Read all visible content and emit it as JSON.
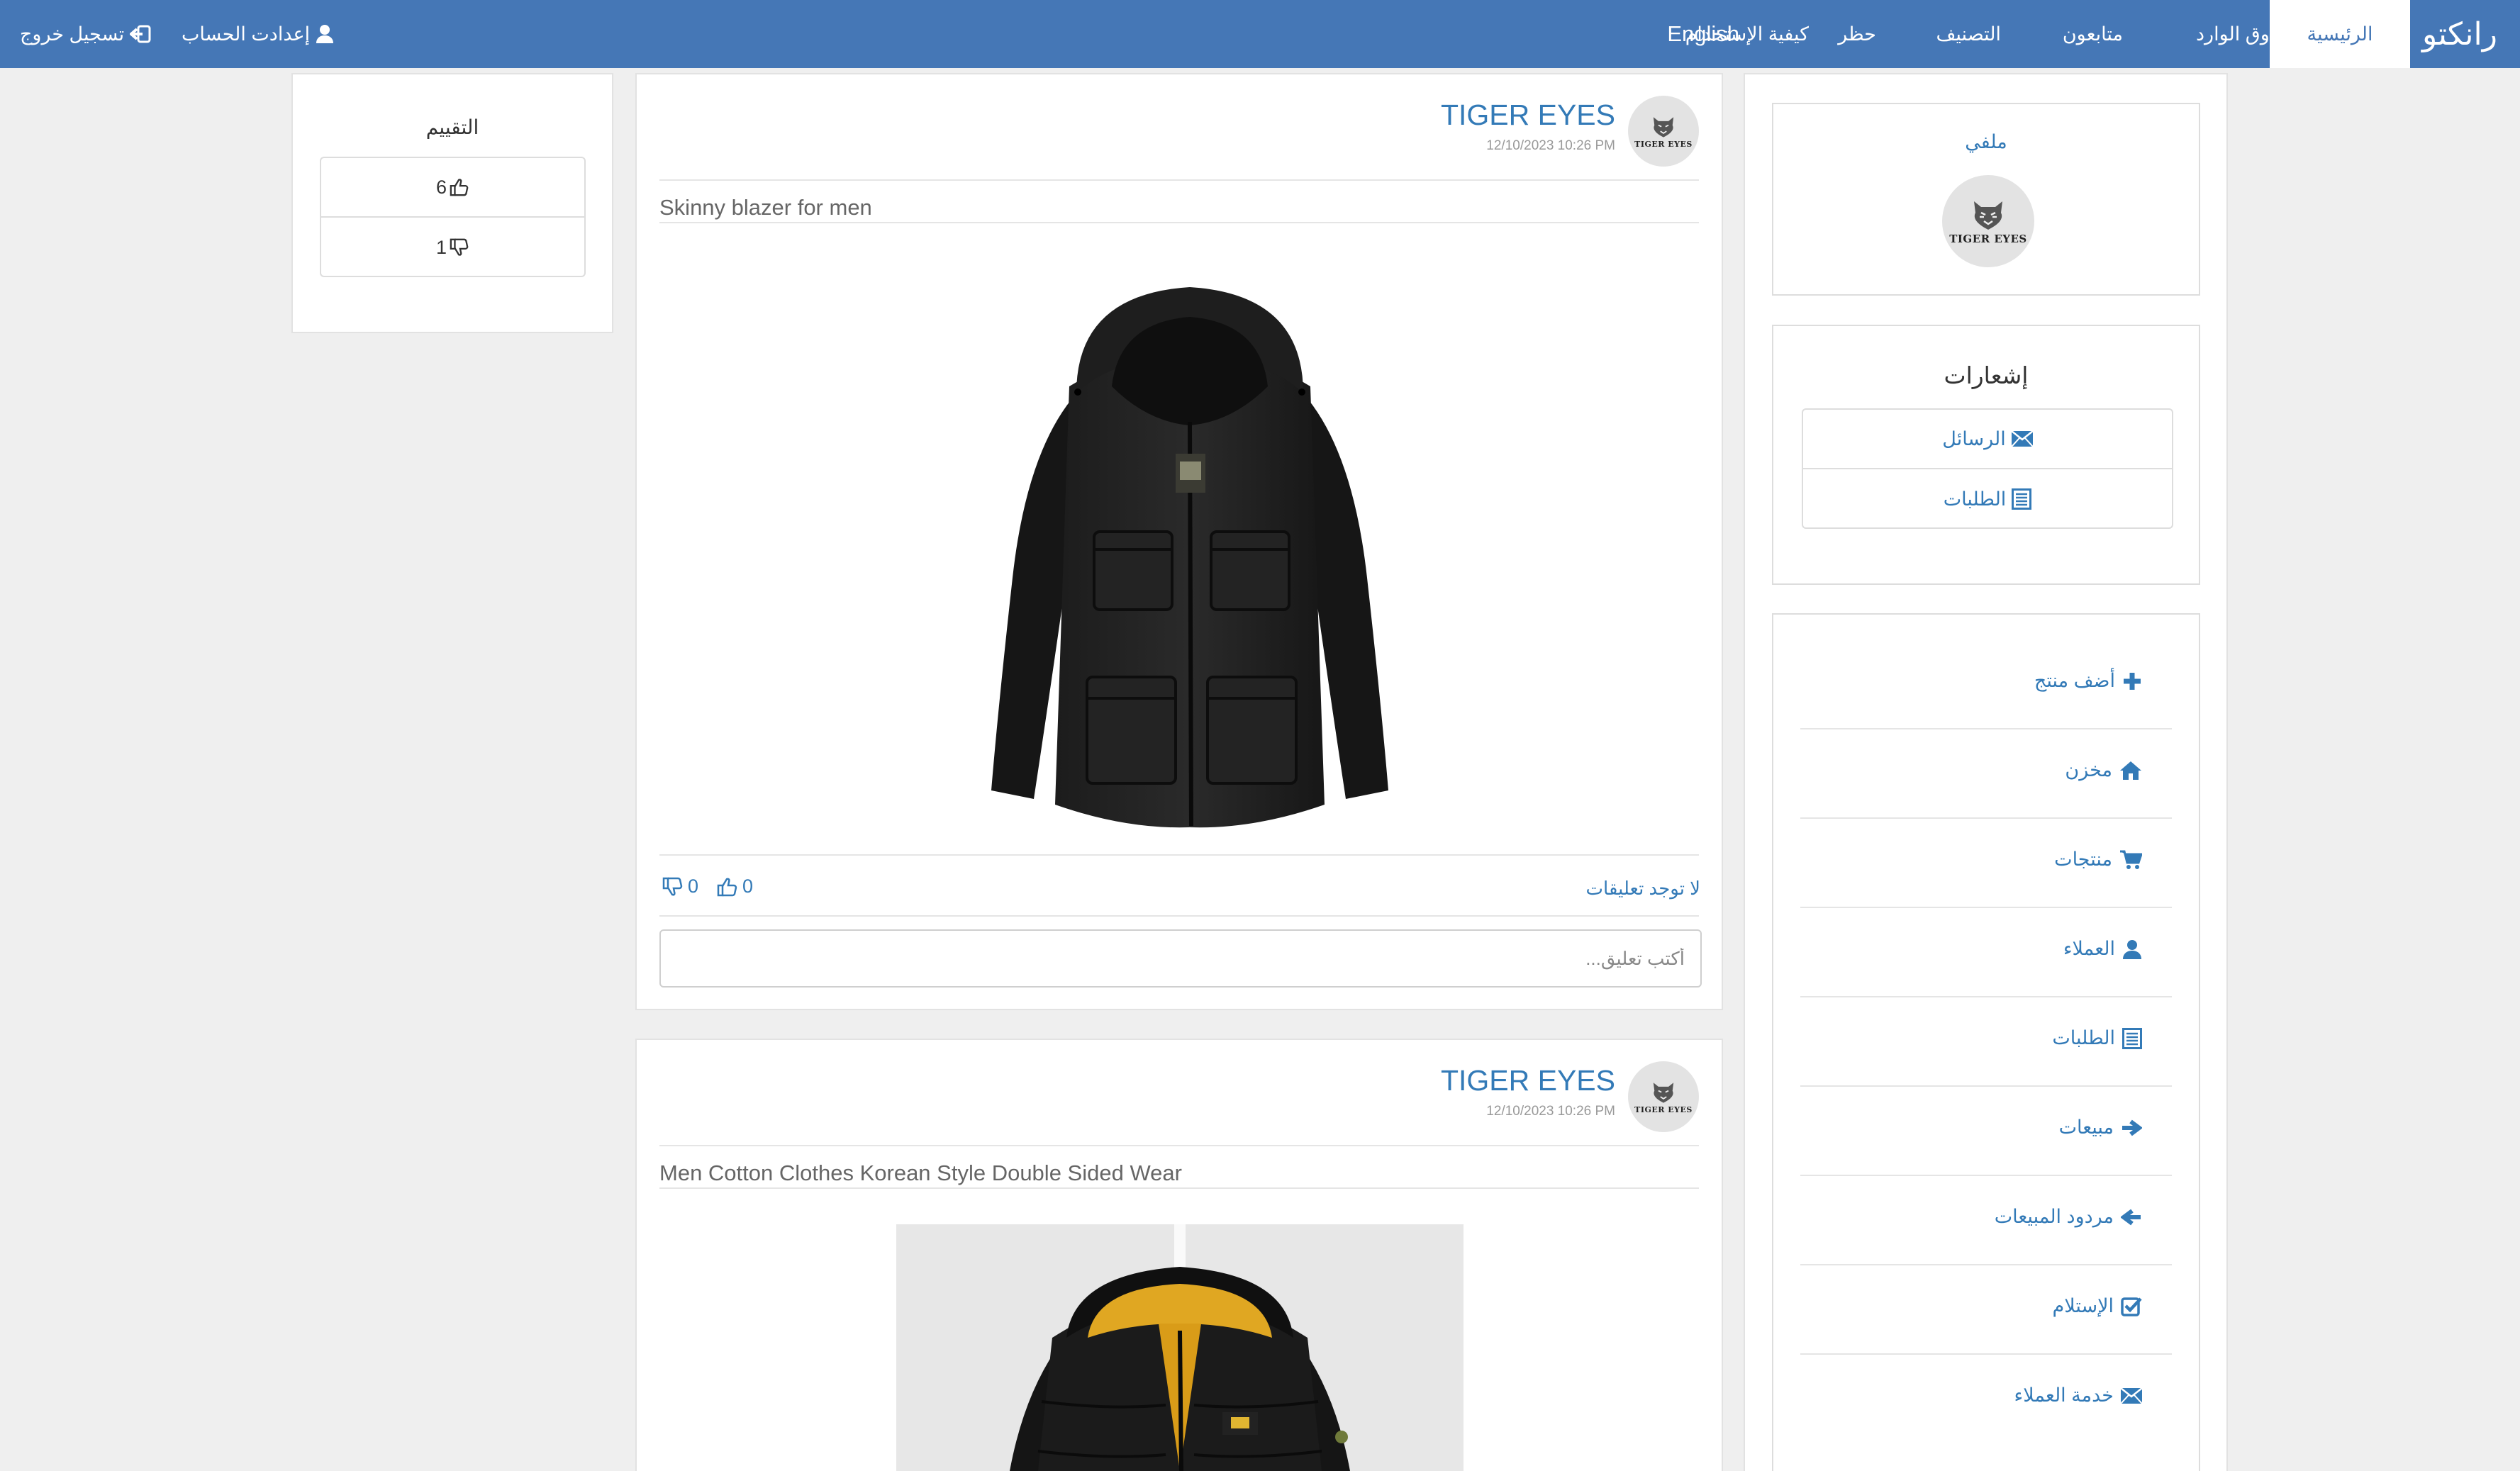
{
  "nav": {
    "brand": "رانكتو",
    "items": [
      {
        "label": "الرئيسية",
        "active": true
      },
      {
        "label": "صندوق الوارد"
      },
      {
        "label": "متابعون"
      },
      {
        "label": "التصنيف"
      },
      {
        "label": "حظر"
      },
      {
        "label": "كيفية الإستخدام"
      },
      {
        "label": "English"
      }
    ],
    "account_settings": "إعدادت الحساب",
    "logout": "تسجيل خروج"
  },
  "profile": {
    "link": "ملفي",
    "logo_text": "TIGER EYES"
  },
  "notifications": {
    "title": "إشعارات",
    "items": [
      {
        "label": "الرسائل",
        "icon": "envelope-icon"
      },
      {
        "label": "الطلبات",
        "icon": "list-icon"
      }
    ]
  },
  "menu": {
    "items": [
      {
        "label": "أضف منتج",
        "icon": "plus-icon"
      },
      {
        "label": "مخزن",
        "icon": "home-icon"
      },
      {
        "label": "منتجات",
        "icon": "cart-icon"
      },
      {
        "label": "العملاء",
        "icon": "user-icon"
      },
      {
        "label": "الطلبات",
        "icon": "list-icon"
      },
      {
        "label": "مبيعات",
        "icon": "arrow-right-icon"
      },
      {
        "label": "مردود المبيعات",
        "icon": "arrow-left-icon"
      },
      {
        "label": "الإستلام",
        "icon": "check-square-icon"
      },
      {
        "label": "خدمة العملاء",
        "icon": "envelope-icon"
      }
    ]
  },
  "rating": {
    "title": "التقييم",
    "likes": "6",
    "dislikes": "1"
  },
  "posts": [
    {
      "seller": "TIGER EYES",
      "timestamp": "12/10/2023 10:26 PM",
      "title": "Skinny blazer for men",
      "likes": "0",
      "dislikes": "0",
      "comments_label": "لا توجد تعليقات",
      "comment_placeholder": "أكتب تعليق..."
    },
    {
      "seller": "TIGER EYES",
      "timestamp": "12/10/2023 10:26 PM",
      "title": "Men Cotton Clothes Korean Style Double Sided Wear"
    }
  ],
  "colors": {
    "navbar": "#4577b6",
    "link": "#337ab7",
    "background": "#efefef"
  }
}
